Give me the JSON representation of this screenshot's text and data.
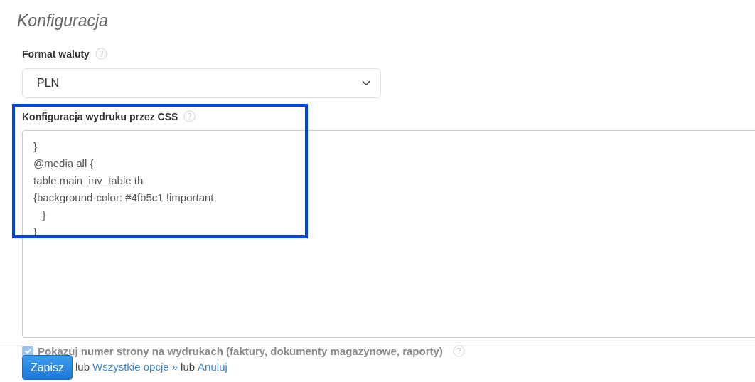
{
  "heading": "Konfiguracja",
  "currency": {
    "label": "Format waluty",
    "value": "PLN"
  },
  "css_config": {
    "label": "Konfiguracja wydruku przez CSS",
    "value": "}\n@media all {\ntable.main_inv_table th\n{background-color: #4fb5c1 !important;\n   }\n}"
  },
  "page_numbers": {
    "label": "Pokazuj numer strony na wydrukach (faktury, dokumenty magazynowe, raporty)",
    "checked": true
  },
  "highlight": {
    "color": "#0047e0"
  },
  "footer": {
    "save": "Zapisz",
    "sep1": "lub",
    "all_options": "Wszystkie opcje »",
    "sep2": "lub",
    "cancel": "Anuluj"
  }
}
